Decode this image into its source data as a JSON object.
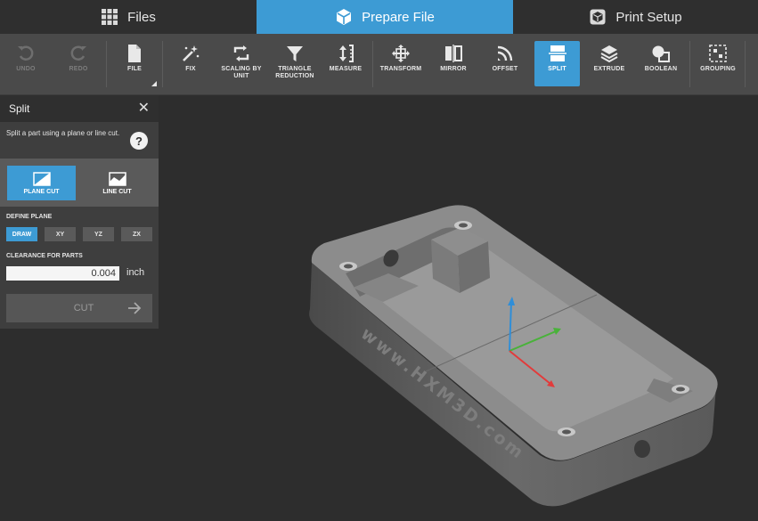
{
  "nav": {
    "tabs": [
      {
        "label": "Files",
        "icon": "grid-icon"
      },
      {
        "label": "Prepare File",
        "icon": "cube-icon",
        "active": true
      },
      {
        "label": "Print Setup",
        "icon": "print-cube-icon"
      }
    ]
  },
  "toolbar": {
    "tools": [
      {
        "label": "UNDO",
        "icon": "undo-icon",
        "enabled": false
      },
      {
        "label": "REDO",
        "icon": "redo-icon",
        "enabled": false
      },
      {
        "label": "FILE",
        "icon": "file-icon",
        "enabled": true
      },
      {
        "label": "FIX",
        "icon": "magic-wand-icon",
        "enabled": true
      },
      {
        "label": "SCALING BY UNIT",
        "icon": "scaling-icon",
        "enabled": true
      },
      {
        "label": "TRIANGLE REDUCTION",
        "icon": "funnel-icon",
        "enabled": true
      },
      {
        "label": "MEASURE",
        "icon": "measure-icon",
        "enabled": true
      },
      {
        "label": "TRANSFORM",
        "icon": "transform-icon",
        "enabled": true
      },
      {
        "label": "MIRROR",
        "icon": "mirror-icon",
        "enabled": true
      },
      {
        "label": "OFFSET",
        "icon": "offset-icon",
        "enabled": true
      },
      {
        "label": "SPLIT",
        "icon": "split-icon",
        "enabled": true,
        "active": true
      },
      {
        "label": "EXTRUDE",
        "icon": "extrude-icon",
        "enabled": true
      },
      {
        "label": "BOOLEAN",
        "icon": "boolean-icon",
        "enabled": true
      },
      {
        "label": "GROUPING",
        "icon": "grouping-icon",
        "enabled": true
      }
    ]
  },
  "panel": {
    "title": "Split",
    "description": "Split a part using a plane or line cut.",
    "modes": [
      {
        "label": "PLANE CUT",
        "active": true
      },
      {
        "label": "LINE CUT",
        "active": false
      }
    ],
    "define_plane_label": "DEFINE PLANE",
    "planes": [
      {
        "label": "DRAW",
        "active": true
      },
      {
        "label": "XY",
        "active": false
      },
      {
        "label": "YZ",
        "active": false
      },
      {
        "label": "ZX",
        "active": false
      }
    ],
    "clearance_label": "CLEARANCE FOR PARTS",
    "clearance_value": "0.004",
    "clearance_unit": "inch",
    "cut_label": "CUT"
  },
  "model": {
    "engraved_text": "www.HXM3D.com"
  },
  "colors": {
    "accent": "#3d9bd4",
    "background": "#2d2d2d",
    "toolbar": "#4a4a4a",
    "panel": "#3e3e3e",
    "axis_x": "#e23b3b",
    "axis_y": "#49b23a",
    "axis_z": "#2f8ed8"
  }
}
